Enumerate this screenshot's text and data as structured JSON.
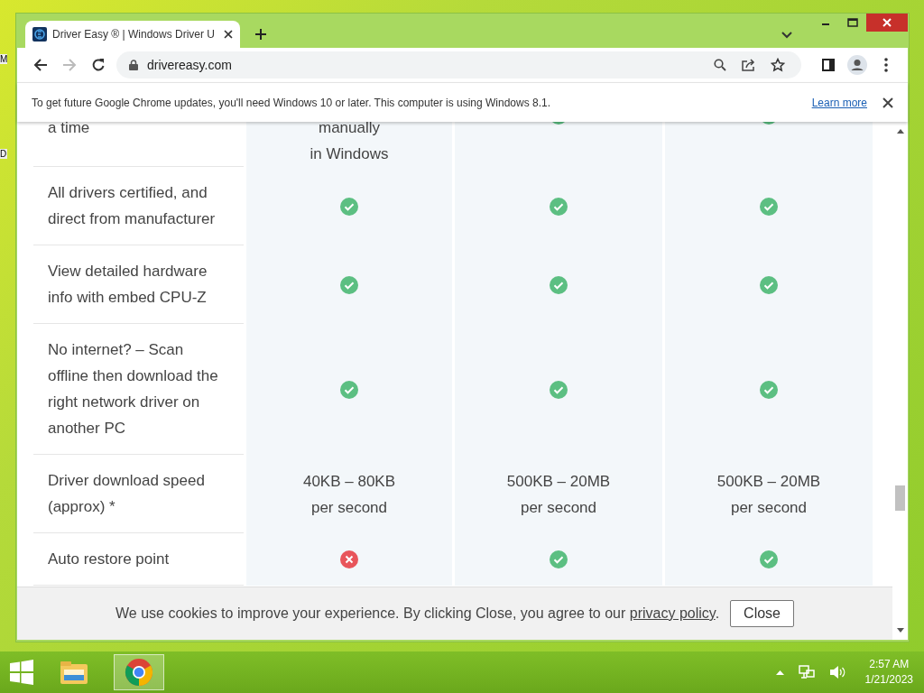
{
  "desktop": {
    "labels": [
      "M",
      "D"
    ]
  },
  "browser": {
    "tab": {
      "title": "Driver Easy ® | Windows Driver U",
      "selected": true
    },
    "address": "drivereasy.com",
    "infobar": {
      "message": "To get future Google Chrome updates, you'll need Windows 10 or later. This computer is using Windows 8.1.",
      "link": "Learn more"
    }
  },
  "table": {
    "rows": [
      {
        "label": "a time",
        "cells": [
          {
            "kind": "text",
            "text": "manually\nin Windows"
          },
          {
            "kind": "check"
          },
          {
            "kind": "check"
          }
        ]
      },
      {
        "label": "All drivers certified, and direct from manufacturer",
        "cells": [
          {
            "kind": "check"
          },
          {
            "kind": "check"
          },
          {
            "kind": "check"
          }
        ]
      },
      {
        "label": "View detailed hardware info with embed CPU-Z",
        "cells": [
          {
            "kind": "check"
          },
          {
            "kind": "check"
          },
          {
            "kind": "check"
          }
        ]
      },
      {
        "label": "No internet? – Scan offline then download the right network driver on another PC",
        "cells": [
          {
            "kind": "check"
          },
          {
            "kind": "check"
          },
          {
            "kind": "check"
          }
        ]
      },
      {
        "label": "Driver download speed (approx) *",
        "cells": [
          {
            "kind": "text",
            "text": "40KB – 80KB\nper second"
          },
          {
            "kind": "text",
            "text": "500KB – 20MB\nper second"
          },
          {
            "kind": "text",
            "text": "500KB – 20MB\nper second"
          }
        ]
      },
      {
        "label": "Auto restore point",
        "cells": [
          {
            "kind": "cross"
          },
          {
            "kind": "check"
          },
          {
            "kind": "check"
          }
        ]
      }
    ]
  },
  "cookie_bar": {
    "text": "We use cookies to improve your experience. By clicking Close, you agree to our ",
    "link": "privacy policy",
    "after": ".",
    "button": "Close"
  },
  "taskbar": {
    "apps": [
      {
        "kind": "explorer",
        "selected": false
      },
      {
        "kind": "chrome",
        "selected": true
      }
    ],
    "time": "2:57 AM",
    "date": "1/21/2023"
  }
}
